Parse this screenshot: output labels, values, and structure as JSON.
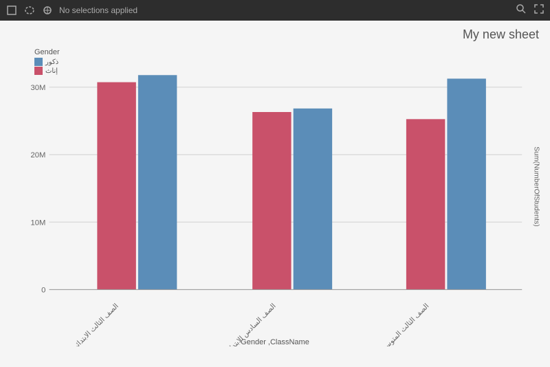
{
  "toolbar": {
    "status": "No selections applied",
    "icons": [
      "selection-icon",
      "lasso-icon",
      "snap-icon",
      "search-icon",
      "expand-icon"
    ]
  },
  "sheet": {
    "title": "My new sheet"
  },
  "chart": {
    "x_axis_label": "Gender ,ClassName",
    "y_axis_label": "Sum(NumberOfStudents)",
    "legend_title": "Gender",
    "legend_items": [
      {
        "label": "ذكور",
        "color": "#5b8db8"
      },
      {
        "label": "إناث",
        "color": "#c9516a"
      }
    ],
    "y_ticks": [
      "0",
      "10M",
      "20M",
      "30M"
    ],
    "categories": [
      {
        "label": "الصف الثالث الابتدائي",
        "male_val": 32000000,
        "female_val": 31000000
      },
      {
        "label": "الصف السادس الابتدائي",
        "male_val": 27000000,
        "female_val": 26500000
      },
      {
        "label": "الصف الثالث المتوسط",
        "male_val": 31500000,
        "female_val": 25500000
      }
    ],
    "max_val": 35000000,
    "colors": {
      "male": "#5b8db8",
      "female": "#c9516a",
      "grid_line": "#e0e0e0"
    }
  }
}
